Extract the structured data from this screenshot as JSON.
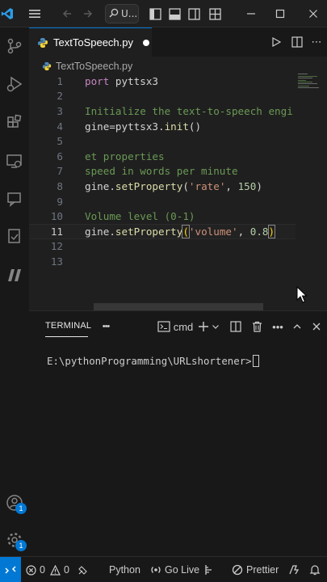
{
  "titlebar": {
    "search_text": "U...",
    "icons": [
      "vscode-logo-icon",
      "menu-icon",
      "back-arrow-icon",
      "forward-arrow-icon",
      "search-icon",
      "toggle-primary-sidebar-icon",
      "toggle-panel-icon",
      "toggle-secondary-sidebar-icon",
      "customize-layout-icon",
      "minimize-icon",
      "maximize-icon",
      "close-icon"
    ]
  },
  "activitybar": {
    "items": [
      "source-control-icon",
      "run-debug-icon",
      "extensions-icon",
      "remote-explorer-icon",
      "chat-icon",
      "docker-icon",
      "bookmarks-icon"
    ],
    "accounts_badge": "1",
    "settings_badge": "1"
  },
  "editor": {
    "tab_label": "TextToSpeech.py",
    "breadcrumb": "TextToSpeech.py",
    "active_line": 11,
    "lines": [
      {
        "n": "1",
        "parts": [
          {
            "t": "port",
            "c": "kw"
          },
          {
            "t": " pyttsx3",
            "c": ""
          }
        ]
      },
      {
        "n": "2",
        "parts": []
      },
      {
        "n": "3",
        "parts": [
          {
            "t": "Initialize the text-to-speech engi",
            "c": "cm"
          }
        ]
      },
      {
        "n": "4",
        "parts": [
          {
            "t": "gine=pyttsx3.",
            "c": ""
          },
          {
            "t": "init",
            "c": "fn"
          },
          {
            "t": "()",
            "c": ""
          }
        ]
      },
      {
        "n": "5",
        "parts": []
      },
      {
        "n": "6",
        "parts": [
          {
            "t": "et properties",
            "c": "cm"
          }
        ]
      },
      {
        "n": "7",
        "parts": [
          {
            "t": "speed in words per minute",
            "c": "cm"
          }
        ]
      },
      {
        "n": "8",
        "parts": [
          {
            "t": "gine.",
            "c": ""
          },
          {
            "t": "setProperty",
            "c": "fn"
          },
          {
            "t": "(",
            "c": ""
          },
          {
            "t": "'rate'",
            "c": "str"
          },
          {
            "t": ", ",
            "c": ""
          },
          {
            "t": "150",
            "c": "num"
          },
          {
            "t": ")",
            "c": ""
          }
        ]
      },
      {
        "n": "9",
        "parts": []
      },
      {
        "n": "10",
        "parts": [
          {
            "t": "Volume level (0-1)",
            "c": "cm"
          }
        ]
      },
      {
        "n": "11",
        "parts": [
          {
            "t": "gine.",
            "c": ""
          },
          {
            "t": "setProperty",
            "c": "fn"
          },
          {
            "t": "(",
            "c": "br"
          },
          {
            "t": "'volume'",
            "c": "str"
          },
          {
            "t": ", ",
            "c": ""
          },
          {
            "t": "0.8",
            "c": "num"
          },
          {
            "t": ")",
            "c": "br"
          }
        ]
      },
      {
        "n": "12",
        "parts": []
      },
      {
        "n": "13",
        "parts": []
      }
    ]
  },
  "panel": {
    "tab_label": "TERMINAL",
    "more_label": "•••",
    "shell_label": "cmd",
    "prompt": "E:\\pythonProgramming\\URLshortener>"
  },
  "statusbar": {
    "errors": "0",
    "warnings": "0",
    "language": "Python",
    "go_live": "Go Live",
    "prettier": "Prettier"
  },
  "colors": {
    "accent": "#0078d4",
    "comment": "#6a9955",
    "string": "#ce9178",
    "number": "#b5cea8",
    "function": "#dcdcaa",
    "keyword": "#c586c0"
  }
}
